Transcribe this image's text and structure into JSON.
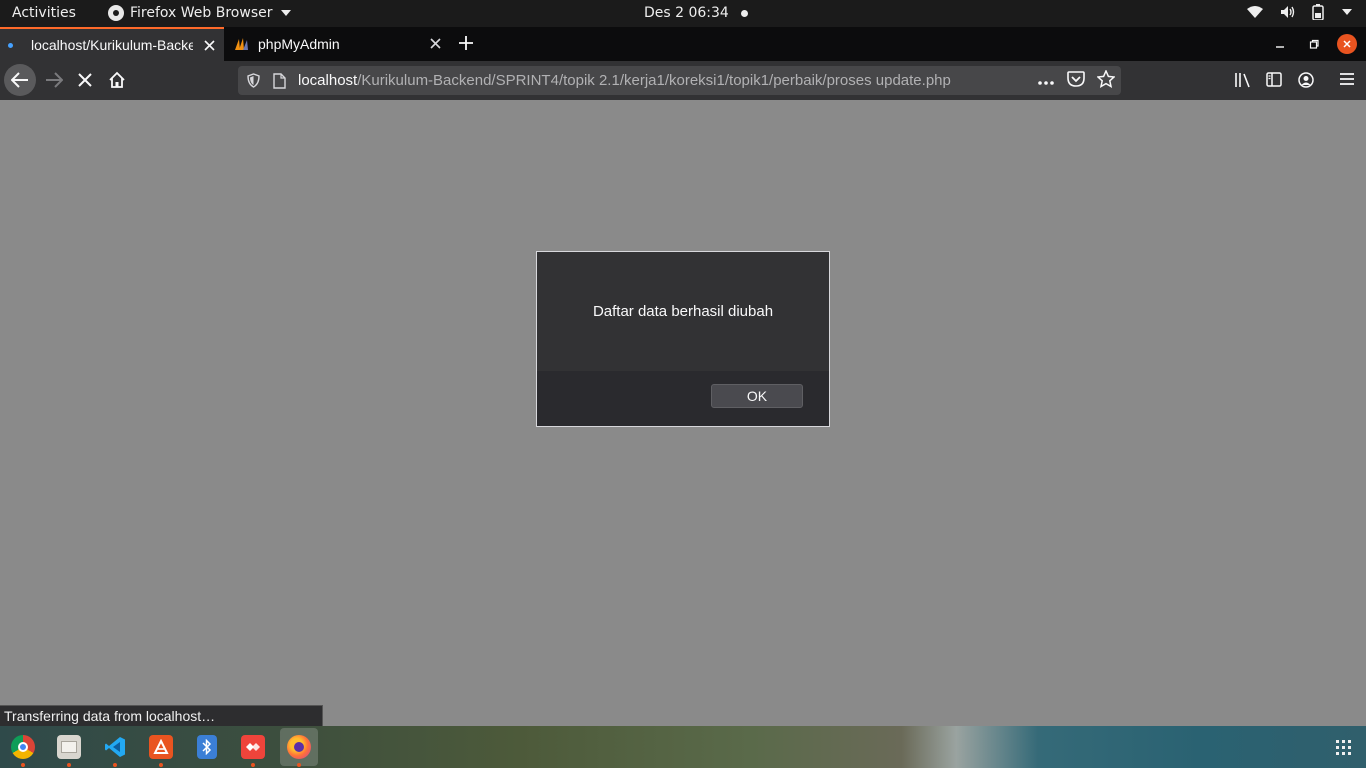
{
  "topbar": {
    "activities": "Activities",
    "app_name": "Firefox Web Browser",
    "clock": "Des 2  06:34"
  },
  "tabs": [
    {
      "title": "localhost/Kurikulum-Backend",
      "active": true,
      "loading": true
    },
    {
      "title": "phpMyAdmin",
      "active": false
    }
  ],
  "urlbar": {
    "host": "localhost",
    "path": "/Kurikulum-Backend/SPRINT4/topik 2.1/kerja1/koreksi1/topik1/perbaik/proses update.php"
  },
  "dialog": {
    "message": "Daftar data berhasil diubah",
    "ok_label": "OK"
  },
  "status": {
    "text": "Transferring data from localhost…"
  },
  "dock": {
    "items": [
      "chrome-icon",
      "files-icon",
      "vscode-icon",
      "software-center-icon",
      "bluetooth-icon",
      "anydesk-icon",
      "firefox-icon"
    ],
    "active_item": "firefox-icon"
  },
  "colors": {
    "accent": "#e95420",
    "tab_highlight": "#ff6a2a",
    "page_background": "#8a8a8a"
  }
}
